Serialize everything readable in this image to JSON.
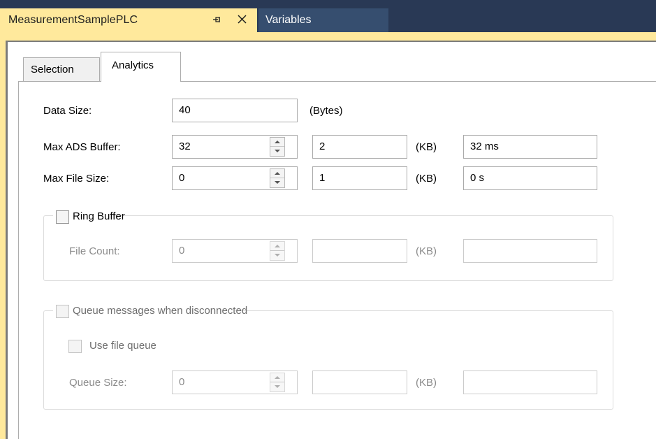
{
  "doc_tabs": {
    "active": {
      "title": "MeasurementSamplePLC",
      "pin_glyph": "⇥",
      "close_glyph": "✕"
    },
    "inactive": {
      "title": "Variables"
    }
  },
  "colors": {
    "active_tab": "#ffe99c",
    "docbar": "#293955",
    "inactive_tab": "#364e6f",
    "disabled_text": "#8b8b8b"
  },
  "page_tabs": [
    "Selection",
    "Analytics"
  ],
  "selected_tab": "Analytics",
  "fields": {
    "data_size": {
      "label": "Data Size:",
      "value": "40",
      "unit": "(Bytes)"
    },
    "max_ads_buffer": {
      "label": "Max ADS Buffer:",
      "value": "32",
      "size": "2",
      "unit": "(KB)",
      "time": "32 ms"
    },
    "max_file_size": {
      "label": "Max File Size:",
      "value": "0",
      "size": "1",
      "unit": "(KB)",
      "time": "0 s"
    }
  },
  "ring_buffer": {
    "label": "Ring Buffer",
    "checked": false,
    "file_count": {
      "label": "File Count:",
      "value": "0",
      "size": "",
      "unit": "(KB)",
      "time": ""
    }
  },
  "queue": {
    "label": "Queue messages when disconnected",
    "checked": false,
    "use_file_queue": {
      "label": "Use file queue",
      "checked": false
    },
    "queue_size": {
      "label": "Queue Size:",
      "value": "0",
      "size": "",
      "unit": "(KB)",
      "time": ""
    }
  }
}
